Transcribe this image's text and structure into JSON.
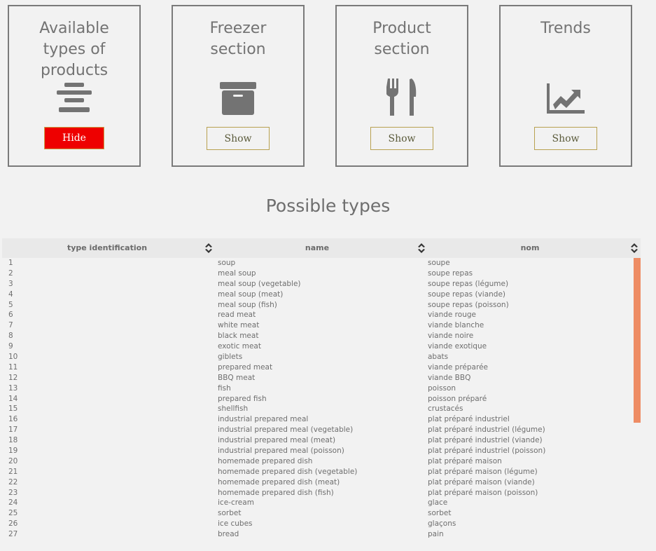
{
  "cards": [
    {
      "title": "Available types of products",
      "button": "Hide",
      "icon": "align-center-icon",
      "active": true
    },
    {
      "title": "Freezer section",
      "button": "Show",
      "icon": "archive-box-icon",
      "active": false
    },
    {
      "title": "Product section",
      "button": "Show",
      "icon": "utensils-icon",
      "active": false
    },
    {
      "title": "Trends",
      "button": "Show",
      "icon": "chart-line-icon",
      "active": false
    }
  ],
  "section_title": "Possible types",
  "table": {
    "columns": [
      "type identification",
      "name",
      "nom"
    ],
    "rows": [
      [
        "1",
        "soup",
        "soupe"
      ],
      [
        "2",
        "meal soup",
        "soupe repas"
      ],
      [
        "3",
        "meal soup (vegetable)",
        "soupe repas (légume)"
      ],
      [
        "4",
        "meal soup (meat)",
        "soupe repas (viande)"
      ],
      [
        "5",
        "meal soup (fish)",
        "soupe repas (poisson)"
      ],
      [
        "6",
        "read meat",
        "viande rouge"
      ],
      [
        "7",
        "white meat",
        "viande blanche"
      ],
      [
        "8",
        "black meat",
        "viande noire"
      ],
      [
        "9",
        "exotic meat",
        "viande exotique"
      ],
      [
        "10",
        "giblets",
        "abats"
      ],
      [
        "11",
        "prepared meat",
        "viande préparée"
      ],
      [
        "12",
        "BBQ meat",
        "viande BBQ"
      ],
      [
        "13",
        "fish",
        "poisson"
      ],
      [
        "14",
        "prepared fish",
        "poisson préparé"
      ],
      [
        "15",
        "shellfish",
        "crustacés"
      ],
      [
        "16",
        "industrial prepared meal",
        "plat préparé industriel"
      ],
      [
        "17",
        "industrial prepared meal (vegetable)",
        "plat préparé industriel (légume)"
      ],
      [
        "18",
        "industrial prepared meal (meat)",
        "plat préparé industriel (viande)"
      ],
      [
        "19",
        "industrial prepared meal (poisson)",
        "plat préparé industriel (poisson)"
      ],
      [
        "20",
        "homemade prepared dish",
        "plat préparé maison"
      ],
      [
        "21",
        "homemade prepared dish (vegetable)",
        "plat préparé maison (légume)"
      ],
      [
        "22",
        "homemade prepared dish (meat)",
        "plat préparé maison (viande)"
      ],
      [
        "23",
        "homemade prepared dish (fish)",
        "plat préparé maison (poisson)"
      ],
      [
        "24",
        "ice-cream",
        "glace"
      ],
      [
        "25",
        "sorbet",
        "sorbet"
      ],
      [
        "26",
        "ice cubes",
        "glaçons"
      ],
      [
        "27",
        "bread",
        "pain"
      ]
    ]
  },
  "colors": {
    "hide_button": "#ee0000",
    "button_border": "#b8a150",
    "scrollbar": "#ee8c64",
    "icon": "#737373"
  }
}
